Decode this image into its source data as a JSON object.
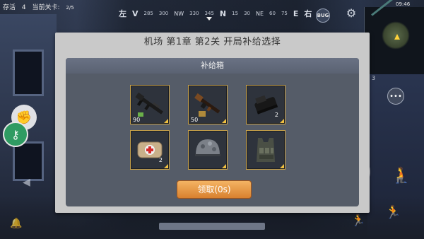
{
  "hud": {
    "alive_label": "存活",
    "alive_count": "4",
    "level_label": "当前关卡:",
    "level_value": "2/5",
    "battery_time": "09:46",
    "bug_label": "BUG",
    "side_number": "3",
    "compass": [
      "左",
      "V",
      "285",
      "300",
      "NW",
      "330",
      "345",
      "N",
      "15",
      "30",
      "NE",
      "60",
      "75",
      "E",
      "右"
    ]
  },
  "dialog": {
    "title": "机场 第1章 第2关 开局补给选择",
    "panel_title": "补给箱",
    "claim_button": "领取(0s)",
    "items": [
      {
        "name": "assault-rifle",
        "icon": "rifle-icon",
        "count": "90"
      },
      {
        "name": "tommy-gun",
        "icon": "smg-icon",
        "count": "50"
      },
      {
        "name": "holo-sight",
        "icon": "scope-icon",
        "count": "2"
      },
      {
        "name": "first-aid-kit",
        "icon": "medkit-icon",
        "count": "2"
      },
      {
        "name": "helmet",
        "icon": "helmet-icon",
        "count": ""
      },
      {
        "name": "body-armor",
        "icon": "vest-icon",
        "count": ""
      }
    ]
  },
  "colors": {
    "slot_border": "#c9a24a",
    "claim_button": "#e89a44",
    "dialog_bg": "#c9c9c9",
    "panel_bg": "#555c68"
  }
}
